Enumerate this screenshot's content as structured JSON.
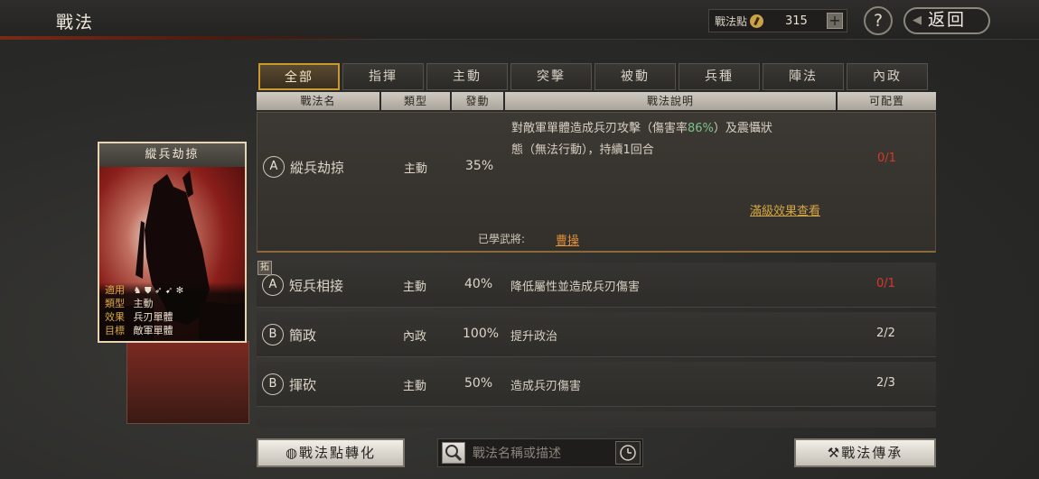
{
  "header": {
    "title": "戰法",
    "points_label": "戰法點",
    "points_value": "315",
    "plus_label": "+",
    "help_label": "?",
    "back_label": "返回"
  },
  "tabs": [
    "全部",
    "指揮",
    "主動",
    "突擊",
    "被動",
    "兵種",
    "陣法",
    "內政"
  ],
  "columns": {
    "name": "戰法名",
    "type": "類型",
    "rate": "發動",
    "desc": "戰法說明",
    "alloc": "可配置"
  },
  "expanded": {
    "grade": "A",
    "name": "縱兵劫掠",
    "type": "主動",
    "rate": "35%",
    "desc_part1": "對敵軍單體造成兵刃攻擊（傷害率",
    "desc_hl": "86%",
    "desc_part2": "）及震懾狀",
    "desc_line2": "態（無法行動），持續1回合",
    "alloc": "0/1",
    "full_effect_link": "滿級效果查看",
    "learned_label": "已學武將:",
    "learned_name": "曹操"
  },
  "rows": [
    {
      "grade": "A",
      "name": "短兵相接",
      "type": "主動",
      "rate": "40%",
      "desc": "降低屬性並造成兵刃傷害",
      "alloc": "0/1"
    },
    {
      "grade": "B",
      "name": "簡政",
      "type": "內政",
      "rate": "100%",
      "desc": "提升政治",
      "alloc": "2/2"
    },
    {
      "grade": "B",
      "name": "揮砍",
      "type": "主動",
      "rate": "50%",
      "desc": "造成兵刃傷害",
      "alloc": "2/3"
    }
  ],
  "corner_badge": "拓",
  "card": {
    "title": "縱兵劫掠",
    "apply_key": "適用",
    "type_key": "類型",
    "type_val": "主動",
    "effect_key": "效果",
    "effect_val": "兵刃單體",
    "target_key": "目標",
    "target_val": "敵軍單體"
  },
  "bottom": {
    "convert_label": "戰法點轉化",
    "search_placeholder": "戰法名稱或描述",
    "inherit_label": "戰法傳承"
  },
  "colors": {
    "accent_gold": "#c9982f",
    "alloc_red": "#d8382a",
    "rate_green": "#7fc48a",
    "link_gold": "#d4a642",
    "learned_orange": "#e08f3a"
  }
}
